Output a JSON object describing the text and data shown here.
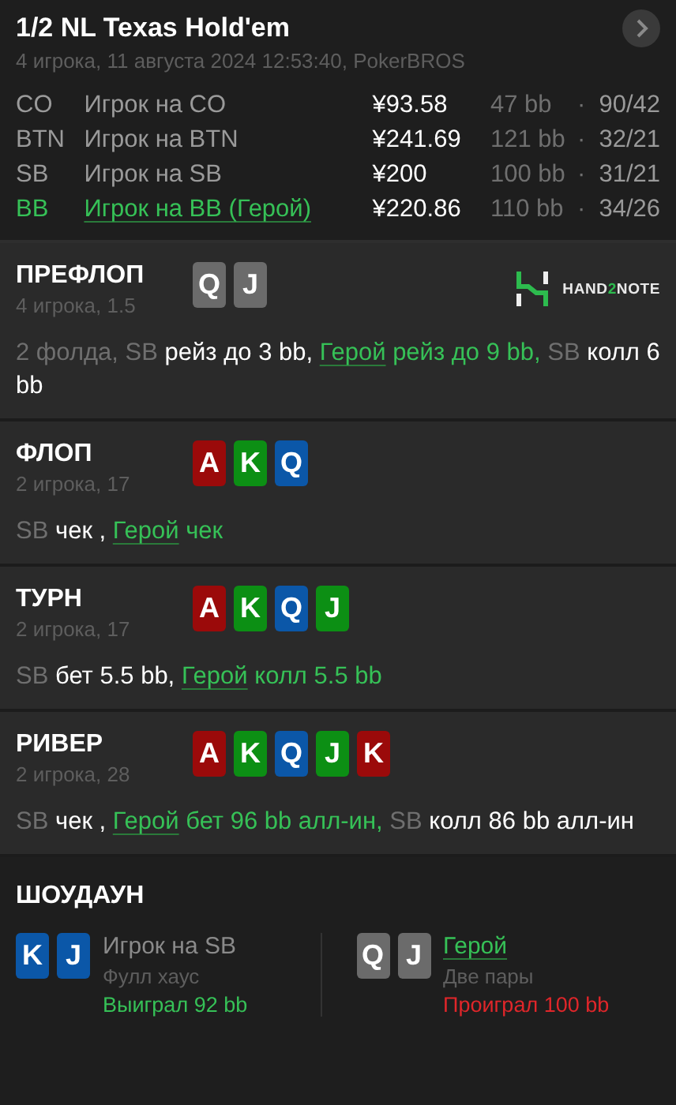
{
  "header": {
    "title": "1/2 NL Texas Hold'em",
    "subtitle": "4 игрока, 11 августа 2024 12:53:40, PokerBROS",
    "players": [
      {
        "position": "CO",
        "name": "Игрок на CO",
        "hero": false,
        "stack": "¥93.58",
        "bb": "47 bb",
        "separator": "·",
        "stats": "90/42"
      },
      {
        "position": "BTN",
        "name": "Игрок на BTN",
        "hero": false,
        "stack": "¥241.69",
        "bb": "121 bb",
        "separator": "·",
        "stats": "32/21"
      },
      {
        "position": "SB",
        "name": "Игрок на SB",
        "hero": false,
        "stack": "¥200",
        "bb": "100 bb",
        "separator": "·",
        "stats": "31/21"
      },
      {
        "position": "BB",
        "name": "Игрок на BB (Герой)",
        "hero": true,
        "stack": "¥220.86",
        "bb": "110 bb",
        "separator": "·",
        "stats": "34/26"
      }
    ]
  },
  "streets": [
    {
      "title": "ПРЕФЛОП",
      "info": "4 игрока, 1.5",
      "logo": [
        {
          "text": "HAND",
          "accent": false
        },
        {
          "text": "2",
          "accent": true
        },
        {
          "text": "NOTE",
          "accent": false
        }
      ],
      "cards": [
        {
          "rank": "Q",
          "color": "#6b6b6b"
        },
        {
          "rank": "J",
          "color": "#6b6b6b"
        }
      ],
      "actions": [
        {
          "kind": "player",
          "text": "2 фолда, SB"
        },
        {
          "kind": "action",
          "text": "рейз до 3 bb,"
        },
        {
          "kind": "hero",
          "text": "Герой"
        },
        {
          "kind": "hero_action",
          "text": "рейз до 9 bb,"
        },
        {
          "kind": "player",
          "text": "SB"
        },
        {
          "kind": "action",
          "text": "колл 6 bb"
        }
      ]
    },
    {
      "title": "ФЛОП",
      "info": "2 игрока, 17",
      "cards": [
        {
          "rank": "A",
          "color": "#9b0a0a"
        },
        {
          "rank": "K",
          "color": "#0c8f14"
        },
        {
          "rank": "Q",
          "color": "#0b57a8"
        }
      ],
      "actions": [
        {
          "kind": "player",
          "text": "SB"
        },
        {
          "kind": "action",
          "text": "чек ,"
        },
        {
          "kind": "hero",
          "text": "Герой"
        },
        {
          "kind": "hero_action",
          "text": "чек"
        }
      ]
    },
    {
      "title": "ТУРН",
      "info": "2 игрока, 17",
      "cards": [
        {
          "rank": "A",
          "color": "#9b0a0a"
        },
        {
          "rank": "K",
          "color": "#0c8f14"
        },
        {
          "rank": "Q",
          "color": "#0b57a8"
        },
        {
          "rank": "J",
          "color": "#0c8f14"
        }
      ],
      "actions": [
        {
          "kind": "player",
          "text": "SB"
        },
        {
          "kind": "action",
          "text": "бет 5.5 bb,"
        },
        {
          "kind": "hero",
          "text": "Герой"
        },
        {
          "kind": "hero_action",
          "text": "колл 5.5 bb"
        }
      ]
    },
    {
      "title": "РИВЕР",
      "info": "2 игрока, 28",
      "cards": [
        {
          "rank": "A",
          "color": "#9b0a0a"
        },
        {
          "rank": "K",
          "color": "#0c8f14"
        },
        {
          "rank": "Q",
          "color": "#0b57a8"
        },
        {
          "rank": "J",
          "color": "#0c8f14"
        },
        {
          "rank": "K",
          "color": "#9b0a0a"
        }
      ],
      "actions": [
        {
          "kind": "player",
          "text": "SB"
        },
        {
          "kind": "action",
          "text": "чек ,"
        },
        {
          "kind": "hero",
          "text": "Герой"
        },
        {
          "kind": "hero_action",
          "text": "бет 96 bb алл-ин,"
        },
        {
          "kind": "player",
          "text": "SB"
        },
        {
          "kind": "action",
          "text": "колл 86 bb алл-ин"
        }
      ]
    }
  ],
  "showdown": {
    "title": "ШОУДАУН",
    "hands": [
      {
        "name": "Игрок на SB",
        "hero": false,
        "hand": "Фулл хаус",
        "result": "Выиграл 92 bb",
        "won": true,
        "cards": [
          {
            "rank": "K",
            "color": "#0b57a8"
          },
          {
            "rank": "J",
            "color": "#0b57a8"
          }
        ]
      },
      {
        "name": "Герой",
        "hero": true,
        "hand": "Две пары",
        "result": "Проиграл 100 bb",
        "won": false,
        "cards": [
          {
            "rank": "Q",
            "color": "#6b6b6b"
          },
          {
            "rank": "J",
            "color": "#6b6b6b"
          }
        ]
      }
    ]
  }
}
